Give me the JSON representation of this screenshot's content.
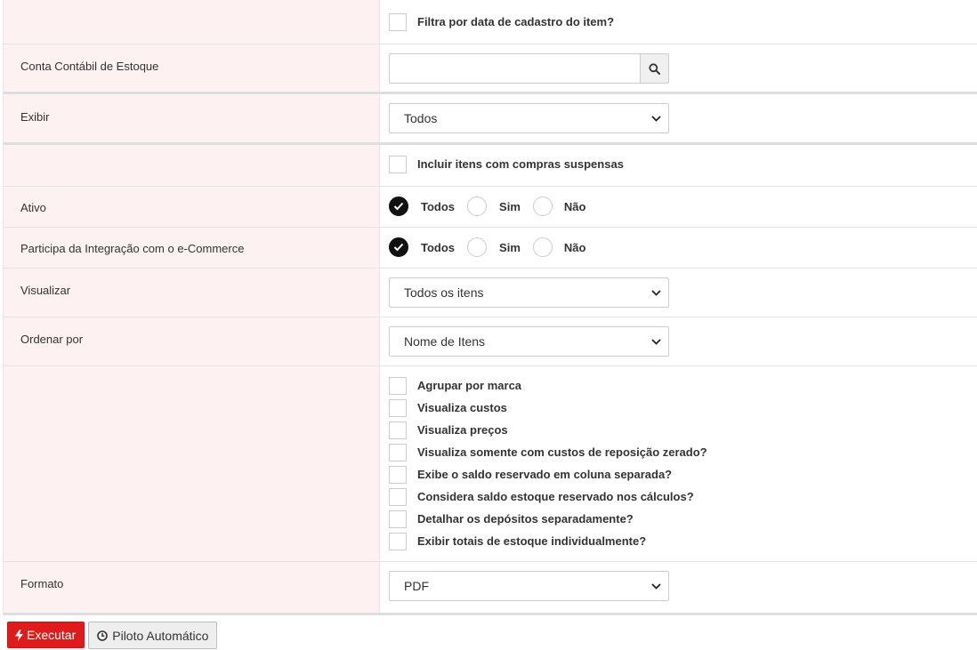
{
  "filters": {
    "filtra_data_label": "Filtra por data de cadastro do item?",
    "conta_contabil_label": "Conta Contábil de Estoque",
    "conta_contabil_value": "",
    "exibir_label": "Exibir",
    "exibir_value": "Todos",
    "incluir_suspensas_label": "Incluir itens com compras suspensas",
    "ativo": {
      "label": "Ativo",
      "options": [
        "Todos",
        "Sim",
        "Não"
      ],
      "selected": "Todos"
    },
    "ecommerce": {
      "label": "Participa da Integração com o e-Commerce",
      "options": [
        "Todos",
        "Sim",
        "Não"
      ],
      "selected": "Todos"
    },
    "visualizar_label": "Visualizar",
    "visualizar_value": "Todos os itens",
    "ordenar_label": "Ordenar por",
    "ordenar_value": "Nome de Itens",
    "checkboxes": [
      "Agrupar por marca",
      "Visualiza custos",
      "Visualiza preços",
      "Visualiza somente com custos de reposição zerado?",
      "Exibe o saldo reservado em coluna separada?",
      "Considera saldo estoque reservado nos cálculos?",
      "Detalhar os depósitos separadamente?",
      "Exibir totais de estoque individualmente?"
    ],
    "formato_label": "Formato",
    "formato_value": "PDF"
  },
  "actions": {
    "executar_label": "Executar",
    "piloto_label": "Piloto Automático"
  },
  "colors": {
    "label_bg": "#fdf1f1",
    "execute_button": "#e01b1b"
  }
}
